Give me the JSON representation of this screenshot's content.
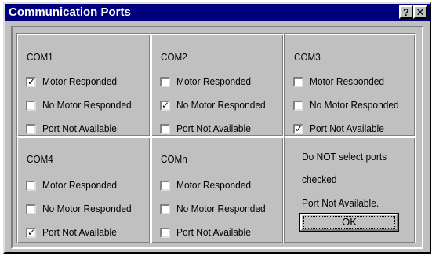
{
  "window": {
    "title": "Communication Ports",
    "help_button": "?",
    "close_button": "✕"
  },
  "ports": [
    {
      "name": "COM1",
      "options": [
        {
          "label": "Motor Responded",
          "checked": true
        },
        {
          "label": "No Motor Responded",
          "checked": false
        },
        {
          "label": "Port Not Available",
          "checked": false
        }
      ]
    },
    {
      "name": "COM2",
      "options": [
        {
          "label": "Motor Responded",
          "checked": false
        },
        {
          "label": "No Motor Responded",
          "checked": true
        },
        {
          "label": "Port Not Available",
          "checked": false
        }
      ]
    },
    {
      "name": "COM3",
      "options": [
        {
          "label": "Motor Responded",
          "checked": false
        },
        {
          "label": "No Motor Responded",
          "checked": false
        },
        {
          "label": "Port Not Available",
          "checked": true
        }
      ]
    },
    {
      "name": "COM4",
      "options": [
        {
          "label": "Motor Responded",
          "checked": false
        },
        {
          "label": "No Motor Responded",
          "checked": false
        },
        {
          "label": "Port Not Available",
          "checked": true
        }
      ]
    },
    {
      "name": "COMn",
      "options": [
        {
          "label": "Motor Responded",
          "checked": false
        },
        {
          "label": "No Motor Responded",
          "checked": false
        },
        {
          "label": "Port Not Available",
          "checked": false
        }
      ]
    }
  ],
  "note": {
    "line1": "Do NOT select ports",
    "line2": "checked",
    "line3": "Port Not Available."
  },
  "ok_label": "OK",
  "check_glyph": "✓",
  "colors": {
    "titlebar": "#00007f",
    "face": "#c0c0c0"
  }
}
